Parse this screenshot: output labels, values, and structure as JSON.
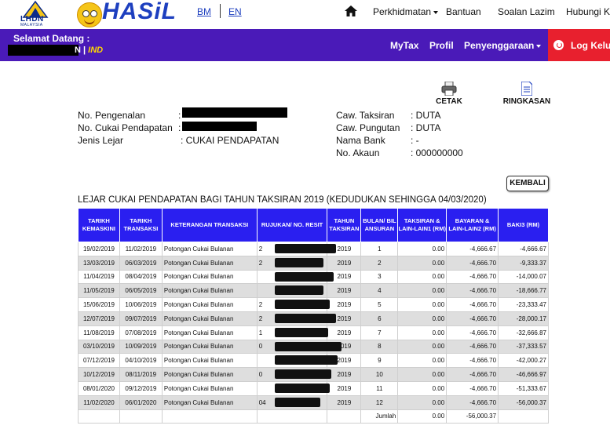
{
  "header": {
    "logo_lhdn_text": "LHDN",
    "logo_lhdn_sub": "MALAYSIA",
    "logo_hasil_text": "HASiL",
    "lang_bm": "BM",
    "lang_en": "EN",
    "nav": [
      "Perkhidmatan",
      "Bantuan",
      "Soalan Lazim",
      "Hubungi Kami"
    ]
  },
  "userbar": {
    "welcome": "Selamat Datang :",
    "lang_name_suffix": "N",
    "lang_sep": "|",
    "lang_ind": "IND",
    "nav": [
      "MyTax",
      "Profil",
      "Penyenggaraan"
    ],
    "logout": "Log Keluar"
  },
  "actions": {
    "print": "CETAK",
    "summary": "RINGKASAN"
  },
  "info_left": [
    {
      "label": "No. Pengenalan",
      "prefix": ":"
    },
    {
      "label": "No. Cukai Pendapatan",
      "prefix": ":"
    },
    {
      "label": "Jenis Lejar",
      "value": ": CUKAI PENDAPATAN"
    }
  ],
  "info_right": [
    {
      "label": "Caw. Taksiran",
      "value": ": DUTA"
    },
    {
      "label": "Caw. Pungutan",
      "value": ": DUTA"
    },
    {
      "label": "Nama Bank",
      "value": ": -"
    },
    {
      "label": "No. Akaun",
      "value": ": 000000000"
    }
  ],
  "back_button": "KEMBALI",
  "ledger_title": "LEJAR CUKAI PENDAPATAN BAGI TAHUN TAKSIRAN 2019 (KEDUDUKAN SEHINGGA 04/03/2020)",
  "table": {
    "headers": [
      "TARIKH KEMASKINI",
      "TARIKH TRANSAKSI",
      "KETERANGAN TRANSAKSI",
      "RUJUKAN/ NO. RESIT",
      "TAHUN TAKSIRAN",
      "BULAN/ BIL ANSURAN",
      "TAKSIRAN & LAIN-LAIN1 (RM)",
      "BAYARAN & LAIN-LAIN2 (RM)",
      "BAKI3 (RM)"
    ],
    "rows": [
      {
        "updated": "19/02/2019",
        "trans": "11/02/2019",
        "desc": "Potongan Cukai Bulanan",
        "ref_prefix": "2",
        "year": "2019",
        "inst": "1",
        "assess": "0.00",
        "paid": "-4,666.67",
        "bal": "-4,666.67"
      },
      {
        "updated": "13/03/2019",
        "trans": "06/03/2019",
        "desc": "Potongan Cukai Bulanan",
        "ref_prefix": "2",
        "year": "2019",
        "inst": "2",
        "assess": "0.00",
        "paid": "-4,666.70",
        "bal": "-9,333.37"
      },
      {
        "updated": "11/04/2019",
        "trans": "08/04/2019",
        "desc": "Potongan Cukai Bulanan",
        "ref_prefix": "",
        "year": "2019",
        "inst": "3",
        "assess": "0.00",
        "paid": "-4,666.70",
        "bal": "-14,000.07"
      },
      {
        "updated": "11/05/2019",
        "trans": "06/05/2019",
        "desc": "Potongan Cukai Bulanan",
        "ref_prefix": "",
        "year": "2019",
        "inst": "4",
        "assess": "0.00",
        "paid": "-4,666.70",
        "bal": "-18,666.77"
      },
      {
        "updated": "15/06/2019",
        "trans": "10/06/2019",
        "desc": "Potongan Cukai Bulanan",
        "ref_prefix": "2",
        "year": "2019",
        "inst": "5",
        "assess": "0.00",
        "paid": "-4,666.70",
        "bal": "-23,333.47"
      },
      {
        "updated": "12/07/2019",
        "trans": "09/07/2019",
        "desc": "Potongan Cukai Bulanan",
        "ref_prefix": "2",
        "year": "2019",
        "inst": "6",
        "assess": "0.00",
        "paid": "-4,666.70",
        "bal": "-28,000.17"
      },
      {
        "updated": "11/08/2019",
        "trans": "07/08/2019",
        "desc": "Potongan Cukai Bulanan",
        "ref_prefix": "1",
        "year": "2019",
        "inst": "7",
        "assess": "0.00",
        "paid": "-4,666.70",
        "bal": "-32,666.87"
      },
      {
        "updated": "03/10/2019",
        "trans": "10/09/2019",
        "desc": "Potongan Cukai Bulanan",
        "ref_prefix": "0",
        "year": "2019",
        "inst": "8",
        "assess": "0.00",
        "paid": "-4,666.70",
        "bal": "-37,333.57"
      },
      {
        "updated": "07/12/2019",
        "trans": "04/10/2019",
        "desc": "Potongan Cukai Bulanan",
        "ref_prefix": "",
        "year": "2019",
        "inst": "9",
        "assess": "0.00",
        "paid": "-4,666.70",
        "bal": "-42,000.27"
      },
      {
        "updated": "10/12/2019",
        "trans": "08/11/2019",
        "desc": "Potongan Cukai Bulanan",
        "ref_prefix": "0",
        "year": "2019",
        "inst": "10",
        "assess": "0.00",
        "paid": "-4,666.70",
        "bal": "-46,666.97"
      },
      {
        "updated": "08/01/2020",
        "trans": "09/12/2019",
        "desc": "Potongan Cukai Bulanan",
        "ref_prefix": "",
        "year": "2019",
        "inst": "11",
        "assess": "0.00",
        "paid": "-4,666.70",
        "bal": "-51,333.67"
      },
      {
        "updated": "11/02/2020",
        "trans": "06/01/2020",
        "desc": "Potongan Cukai Bulanan",
        "ref_prefix": "04",
        "year": "2019",
        "inst": "12",
        "assess": "0.00",
        "paid": "-4,666.70",
        "bal": "-56,000.37"
      }
    ],
    "total_label": "Jumlah",
    "total_assess": "0.00",
    "total_paid": "-56,000.37"
  }
}
